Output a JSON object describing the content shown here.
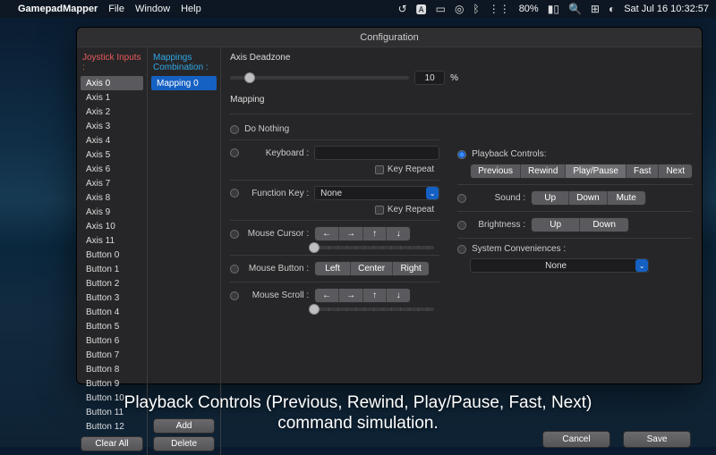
{
  "menubar": {
    "app": "GamepadMapper",
    "items": [
      "File",
      "Window",
      "Help"
    ],
    "battery": "80%",
    "clock": "Sat Jul 16  10:32:57"
  },
  "window": {
    "title": "Configuration",
    "joystick_header": "Joystick Inputs :",
    "mappings_header": "Mappings Combination :",
    "joystick_items": [
      "Axis 0",
      "Axis 1",
      "Axis 2",
      "Axis 3",
      "Axis 4",
      "Axis 5",
      "Axis 6",
      "Axis 7",
      "Axis 8",
      "Axis 9",
      "Axis 10",
      "Axis 11",
      "Button 0",
      "Button 1",
      "Button 2",
      "Button 3",
      "Button 4",
      "Button 5",
      "Button 6",
      "Button 7",
      "Button 8",
      "Button 9",
      "Button 10",
      "Button 11",
      "Button 12"
    ],
    "joystick_selected": 0,
    "mappings_items": [
      "Mapping 0"
    ],
    "mappings_selected": 0,
    "clear_all": "Clear All",
    "add": "Add",
    "delete": "Delete",
    "axis_deadzone": {
      "label": "Axis Deadzone",
      "value": "10",
      "unit": "%"
    },
    "mapping_label": "Mapping",
    "options": {
      "do_nothing": "Do Nothing",
      "keyboard": "Keyboard :",
      "key_repeat": "Key Repeat",
      "function_key": "Function Key :",
      "function_value": "None",
      "mouse_cursor": "Mouse Cursor :",
      "mouse_cursor_dirs": [
        "←",
        "→",
        "↑",
        "↓"
      ],
      "mouse_button": "Mouse Button :",
      "mouse_buttons": [
        "Left",
        "Center",
        "Right"
      ],
      "mouse_scroll": "Mouse Scroll :",
      "playback": "Playback Controls:",
      "playback_segs": [
        "Previous",
        "Rewind",
        "Play/Pause",
        "Fast",
        "Next"
      ],
      "playback_selected": 2,
      "sound": "Sound :",
      "sound_segs": [
        "Up",
        "Down",
        "Mute"
      ],
      "brightness": "Brightness :",
      "brightness_segs": [
        "Up",
        "Down"
      ],
      "sysconv": "System Conveniences :",
      "sysconv_value": "None"
    },
    "cancel": "Cancel",
    "save": "Save"
  },
  "caption_line1": "Playback Controls (Previous, Rewind, Play/Pause, Fast, Next)",
  "caption_line2": "command simulation."
}
